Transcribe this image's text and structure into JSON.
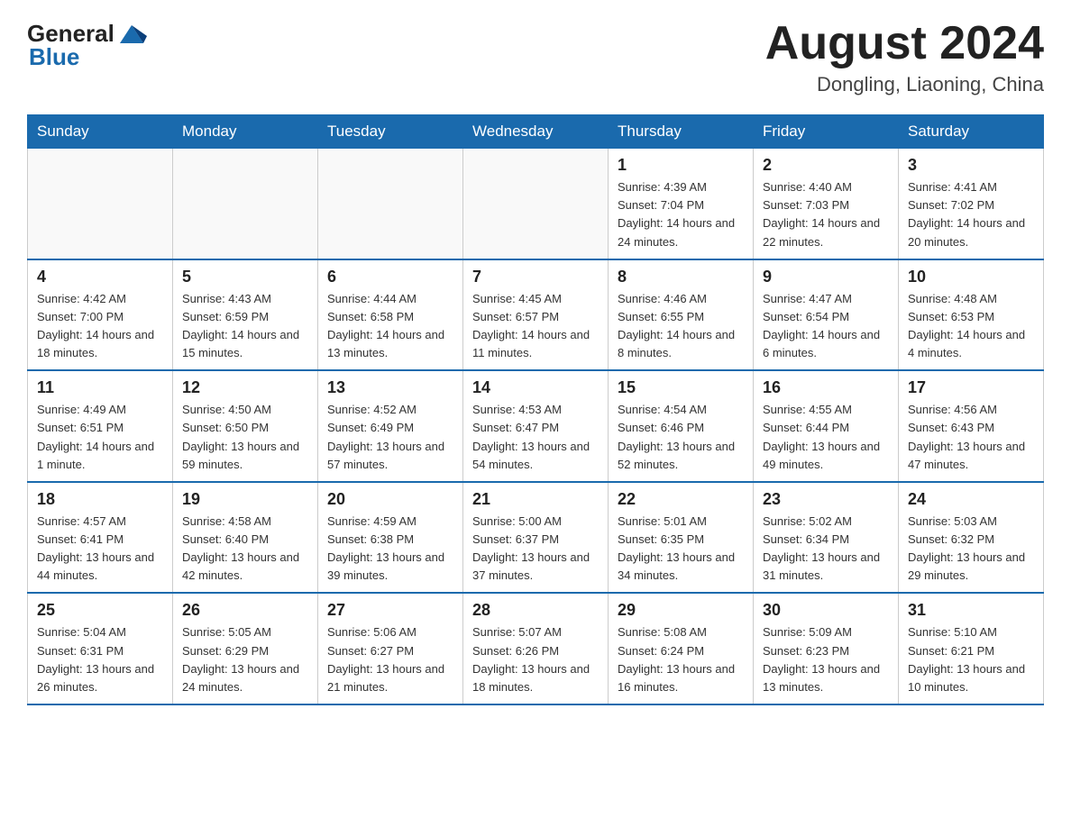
{
  "header": {
    "logo_general": "General",
    "logo_blue": "Blue",
    "month_title": "August 2024",
    "location": "Dongling, Liaoning, China"
  },
  "days_of_week": [
    "Sunday",
    "Monday",
    "Tuesday",
    "Wednesday",
    "Thursday",
    "Friday",
    "Saturday"
  ],
  "weeks": [
    [
      {
        "day": "",
        "info": ""
      },
      {
        "day": "",
        "info": ""
      },
      {
        "day": "",
        "info": ""
      },
      {
        "day": "",
        "info": ""
      },
      {
        "day": "1",
        "info": "Sunrise: 4:39 AM\nSunset: 7:04 PM\nDaylight: 14 hours and 24 minutes."
      },
      {
        "day": "2",
        "info": "Sunrise: 4:40 AM\nSunset: 7:03 PM\nDaylight: 14 hours and 22 minutes."
      },
      {
        "day": "3",
        "info": "Sunrise: 4:41 AM\nSunset: 7:02 PM\nDaylight: 14 hours and 20 minutes."
      }
    ],
    [
      {
        "day": "4",
        "info": "Sunrise: 4:42 AM\nSunset: 7:00 PM\nDaylight: 14 hours and 18 minutes."
      },
      {
        "day": "5",
        "info": "Sunrise: 4:43 AM\nSunset: 6:59 PM\nDaylight: 14 hours and 15 minutes."
      },
      {
        "day": "6",
        "info": "Sunrise: 4:44 AM\nSunset: 6:58 PM\nDaylight: 14 hours and 13 minutes."
      },
      {
        "day": "7",
        "info": "Sunrise: 4:45 AM\nSunset: 6:57 PM\nDaylight: 14 hours and 11 minutes."
      },
      {
        "day": "8",
        "info": "Sunrise: 4:46 AM\nSunset: 6:55 PM\nDaylight: 14 hours and 8 minutes."
      },
      {
        "day": "9",
        "info": "Sunrise: 4:47 AM\nSunset: 6:54 PM\nDaylight: 14 hours and 6 minutes."
      },
      {
        "day": "10",
        "info": "Sunrise: 4:48 AM\nSunset: 6:53 PM\nDaylight: 14 hours and 4 minutes."
      }
    ],
    [
      {
        "day": "11",
        "info": "Sunrise: 4:49 AM\nSunset: 6:51 PM\nDaylight: 14 hours and 1 minute."
      },
      {
        "day": "12",
        "info": "Sunrise: 4:50 AM\nSunset: 6:50 PM\nDaylight: 13 hours and 59 minutes."
      },
      {
        "day": "13",
        "info": "Sunrise: 4:52 AM\nSunset: 6:49 PM\nDaylight: 13 hours and 57 minutes."
      },
      {
        "day": "14",
        "info": "Sunrise: 4:53 AM\nSunset: 6:47 PM\nDaylight: 13 hours and 54 minutes."
      },
      {
        "day": "15",
        "info": "Sunrise: 4:54 AM\nSunset: 6:46 PM\nDaylight: 13 hours and 52 minutes."
      },
      {
        "day": "16",
        "info": "Sunrise: 4:55 AM\nSunset: 6:44 PM\nDaylight: 13 hours and 49 minutes."
      },
      {
        "day": "17",
        "info": "Sunrise: 4:56 AM\nSunset: 6:43 PM\nDaylight: 13 hours and 47 minutes."
      }
    ],
    [
      {
        "day": "18",
        "info": "Sunrise: 4:57 AM\nSunset: 6:41 PM\nDaylight: 13 hours and 44 minutes."
      },
      {
        "day": "19",
        "info": "Sunrise: 4:58 AM\nSunset: 6:40 PM\nDaylight: 13 hours and 42 minutes."
      },
      {
        "day": "20",
        "info": "Sunrise: 4:59 AM\nSunset: 6:38 PM\nDaylight: 13 hours and 39 minutes."
      },
      {
        "day": "21",
        "info": "Sunrise: 5:00 AM\nSunset: 6:37 PM\nDaylight: 13 hours and 37 minutes."
      },
      {
        "day": "22",
        "info": "Sunrise: 5:01 AM\nSunset: 6:35 PM\nDaylight: 13 hours and 34 minutes."
      },
      {
        "day": "23",
        "info": "Sunrise: 5:02 AM\nSunset: 6:34 PM\nDaylight: 13 hours and 31 minutes."
      },
      {
        "day": "24",
        "info": "Sunrise: 5:03 AM\nSunset: 6:32 PM\nDaylight: 13 hours and 29 minutes."
      }
    ],
    [
      {
        "day": "25",
        "info": "Sunrise: 5:04 AM\nSunset: 6:31 PM\nDaylight: 13 hours and 26 minutes."
      },
      {
        "day": "26",
        "info": "Sunrise: 5:05 AM\nSunset: 6:29 PM\nDaylight: 13 hours and 24 minutes."
      },
      {
        "day": "27",
        "info": "Sunrise: 5:06 AM\nSunset: 6:27 PM\nDaylight: 13 hours and 21 minutes."
      },
      {
        "day": "28",
        "info": "Sunrise: 5:07 AM\nSunset: 6:26 PM\nDaylight: 13 hours and 18 minutes."
      },
      {
        "day": "29",
        "info": "Sunrise: 5:08 AM\nSunset: 6:24 PM\nDaylight: 13 hours and 16 minutes."
      },
      {
        "day": "30",
        "info": "Sunrise: 5:09 AM\nSunset: 6:23 PM\nDaylight: 13 hours and 13 minutes."
      },
      {
        "day": "31",
        "info": "Sunrise: 5:10 AM\nSunset: 6:21 PM\nDaylight: 13 hours and 10 minutes."
      }
    ]
  ]
}
